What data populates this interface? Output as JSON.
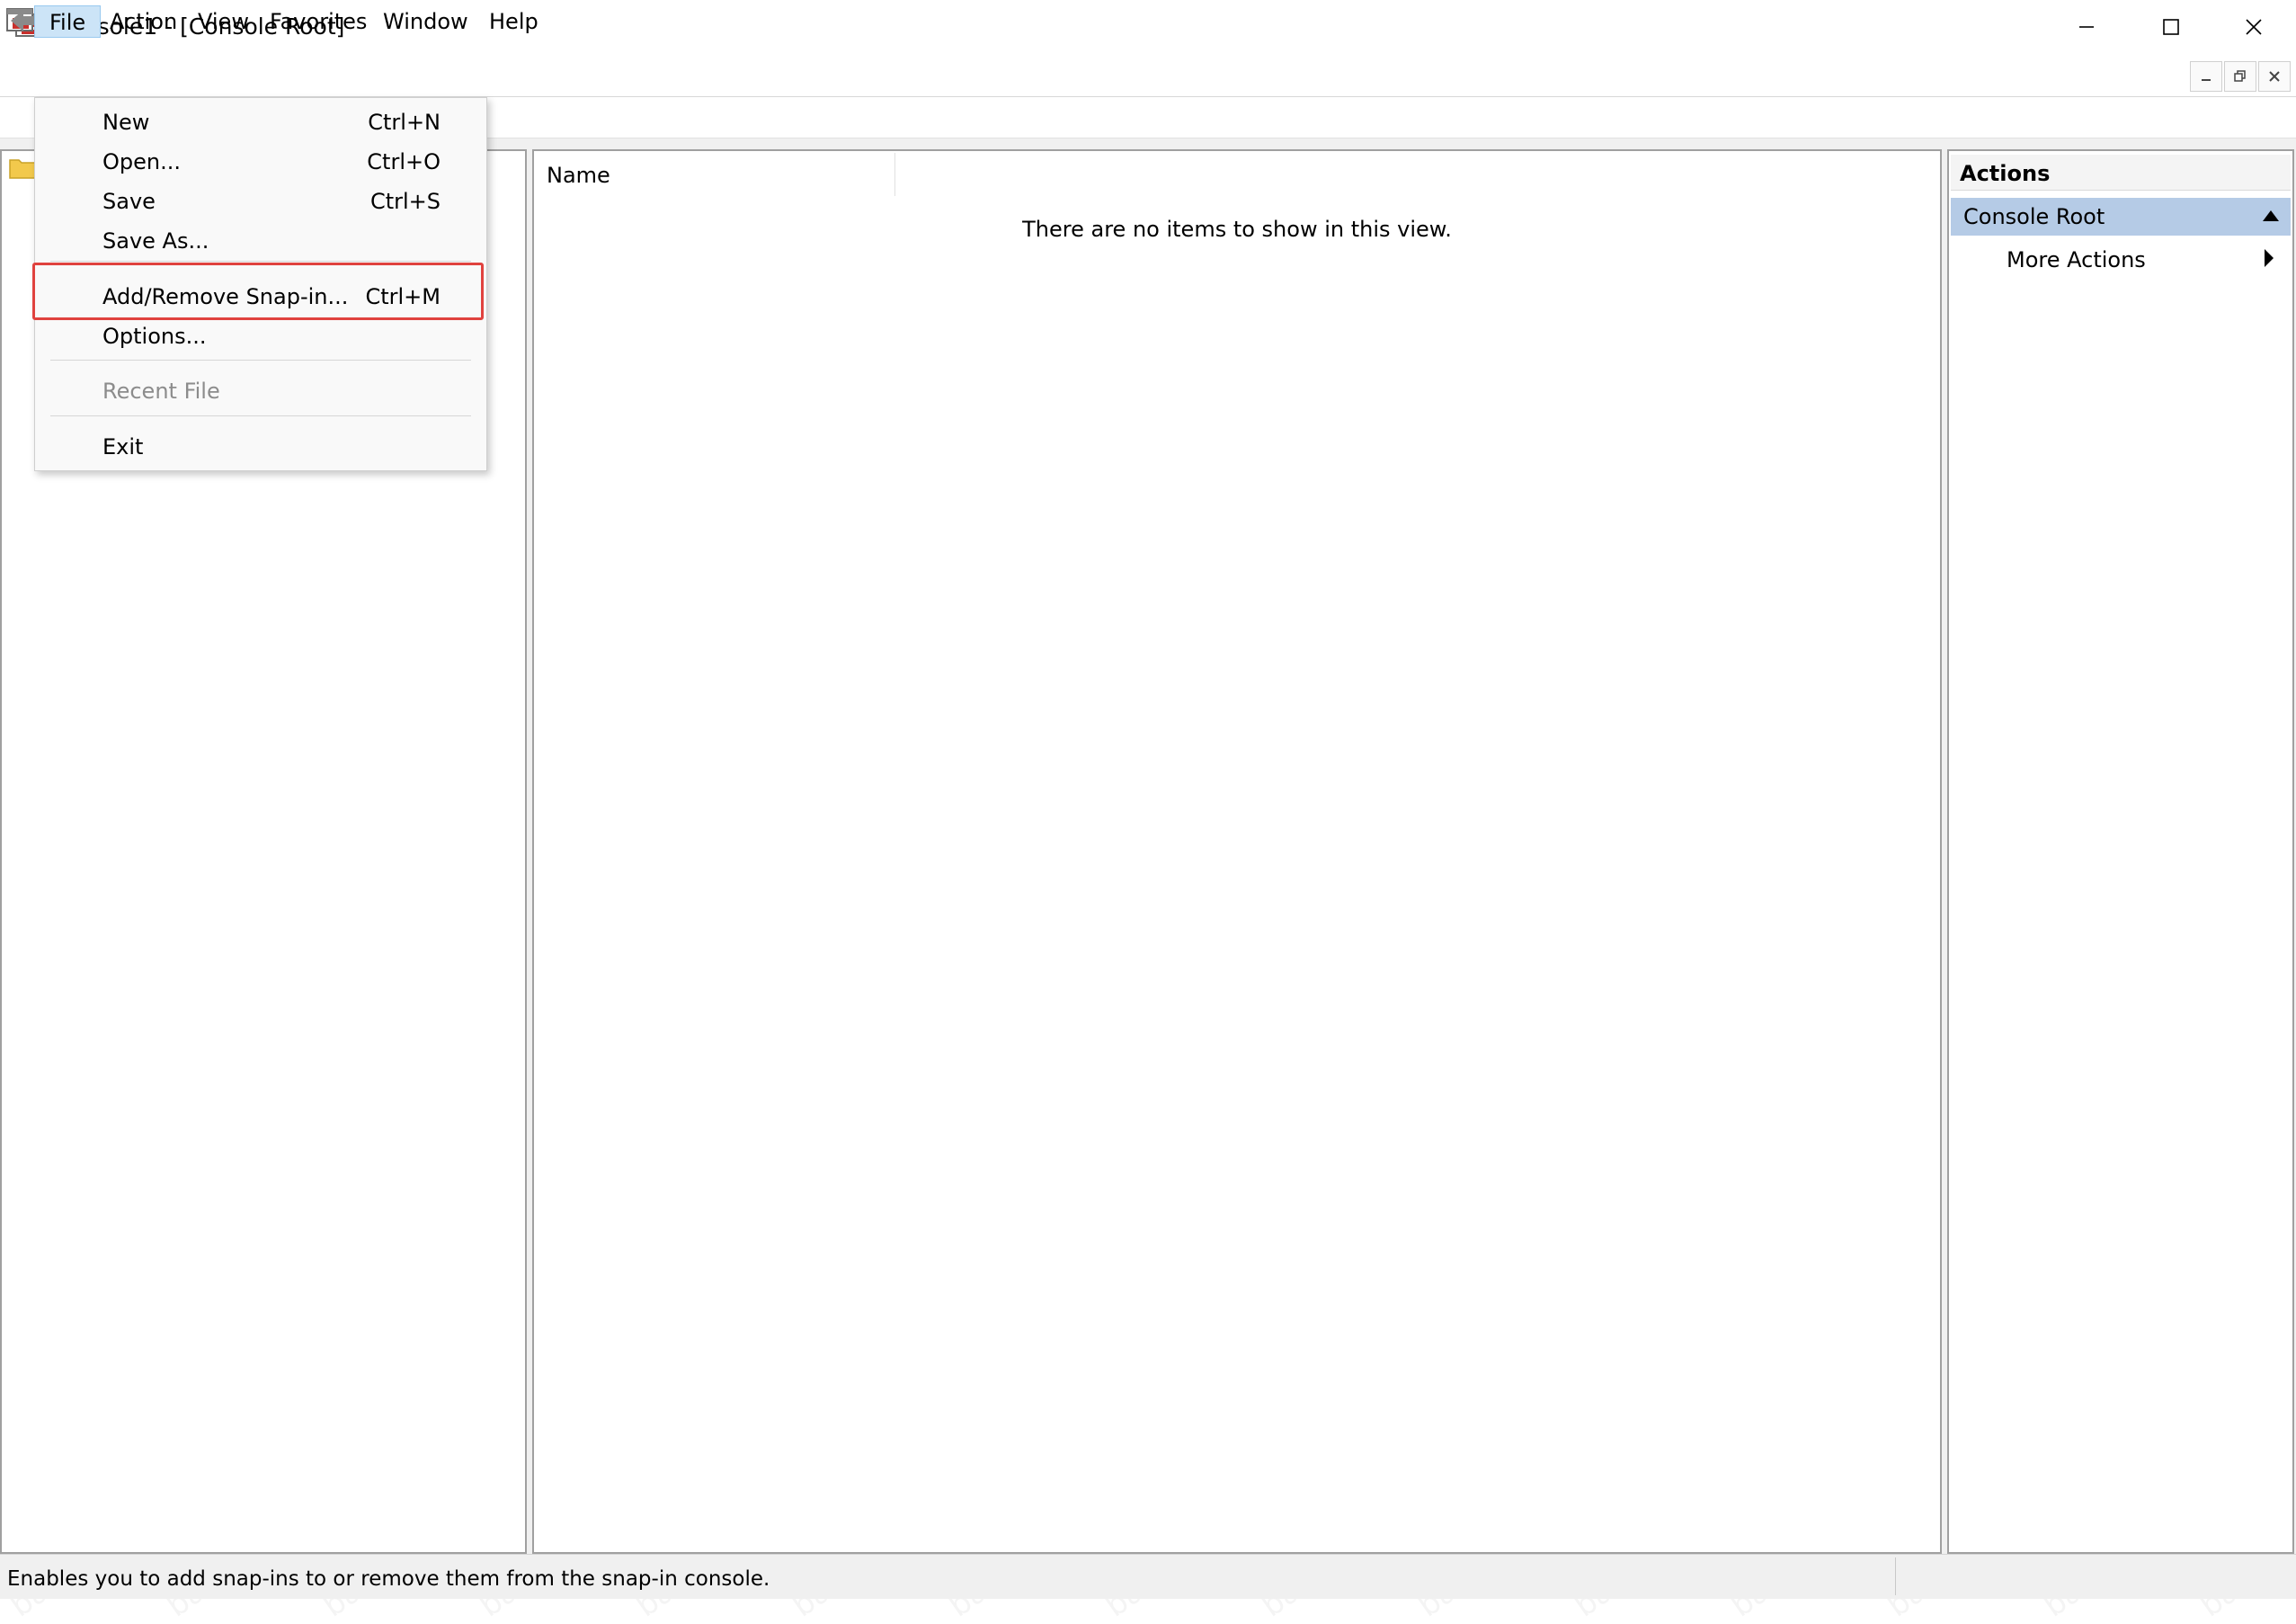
{
  "window": {
    "title": "Console1 - [Console Root]",
    "controls": [
      "minimize-icon",
      "maximize-icon",
      "close-icon"
    ]
  },
  "menubar": {
    "items": [
      "File",
      "Action",
      "View",
      "Favorites",
      "Window",
      "Help"
    ],
    "active": "File"
  },
  "file_menu": {
    "items": [
      {
        "label": "New",
        "shortcut": "Ctrl+N"
      },
      {
        "label": "Open...",
        "shortcut": "Ctrl+O"
      },
      {
        "label": "Save",
        "shortcut": "Ctrl+S"
      },
      {
        "label": "Save As...",
        "shortcut": ""
      },
      {
        "label": "Add/Remove Snap-in...",
        "shortcut": "Ctrl+M",
        "highlighted": true
      },
      {
        "label": "Options...",
        "shortcut": ""
      },
      {
        "label": "Recent File",
        "shortcut": "",
        "disabled": true
      },
      {
        "label": "Exit",
        "shortcut": ""
      }
    ]
  },
  "results": {
    "column_name": "Name",
    "empty_message": "There are no items to show in this view."
  },
  "actions": {
    "title": "Actions",
    "section": "Console Root",
    "items": [
      "More Actions"
    ]
  },
  "statusbar": {
    "text": "Enables you to add snap-ins to or remove them from the snap-in console."
  },
  "watermark": "bakicubuk",
  "colors": {
    "highlight_border": "#e0423e",
    "section_bg": "#b5cbe6",
    "menu_active_bg": "#cce4f7"
  }
}
